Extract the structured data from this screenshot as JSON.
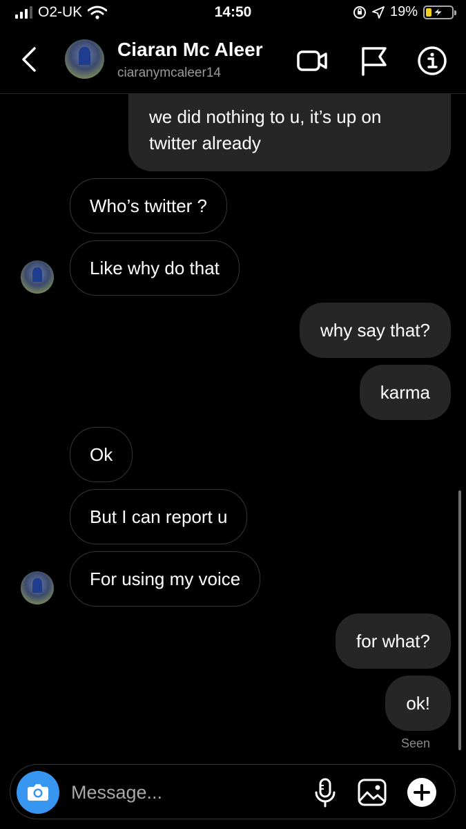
{
  "status_bar": {
    "carrier": "O2-UK",
    "time": "14:50",
    "battery": "19%",
    "battery_level": 0.19,
    "signal_bars_filled": 3,
    "signal_bars_total": 4
  },
  "header": {
    "name": "Ciaran Mc Aleer",
    "username": "ciaranymcaleer14",
    "icons": [
      "back-icon",
      "video-call-icon",
      "flag-icon",
      "info-icon"
    ]
  },
  "thread": {
    "messages": [
      {
        "direction": "outgoing",
        "text": "we did nothing to u, it’s up on twitter already",
        "partial": true
      },
      {
        "direction": "incoming",
        "text": "Who’s twitter ?"
      },
      {
        "direction": "incoming",
        "text": "Like why do that"
      },
      {
        "direction": "outgoing",
        "text": "why say that?"
      },
      {
        "direction": "outgoing",
        "text": "karma"
      },
      {
        "direction": "incoming",
        "text": "Ok"
      },
      {
        "direction": "incoming",
        "text": "But I can report u"
      },
      {
        "direction": "incoming",
        "text": "For using my voice"
      },
      {
        "direction": "outgoing",
        "text": "for what?"
      },
      {
        "direction": "outgoing",
        "text": "ok!"
      }
    ],
    "seen_label": "Seen"
  },
  "composer": {
    "placeholder": "Message...",
    "value": "",
    "icons": [
      "camera-icon",
      "microphone-icon",
      "gallery-icon",
      "add-icon"
    ]
  },
  "colors": {
    "background": "#000000",
    "outgoing_bubble": "#262626",
    "incoming_border": "#363636",
    "camera_button": "#3797f0",
    "secondary_text": "#9a9a9a",
    "battery_fill": "#f5d11e"
  }
}
